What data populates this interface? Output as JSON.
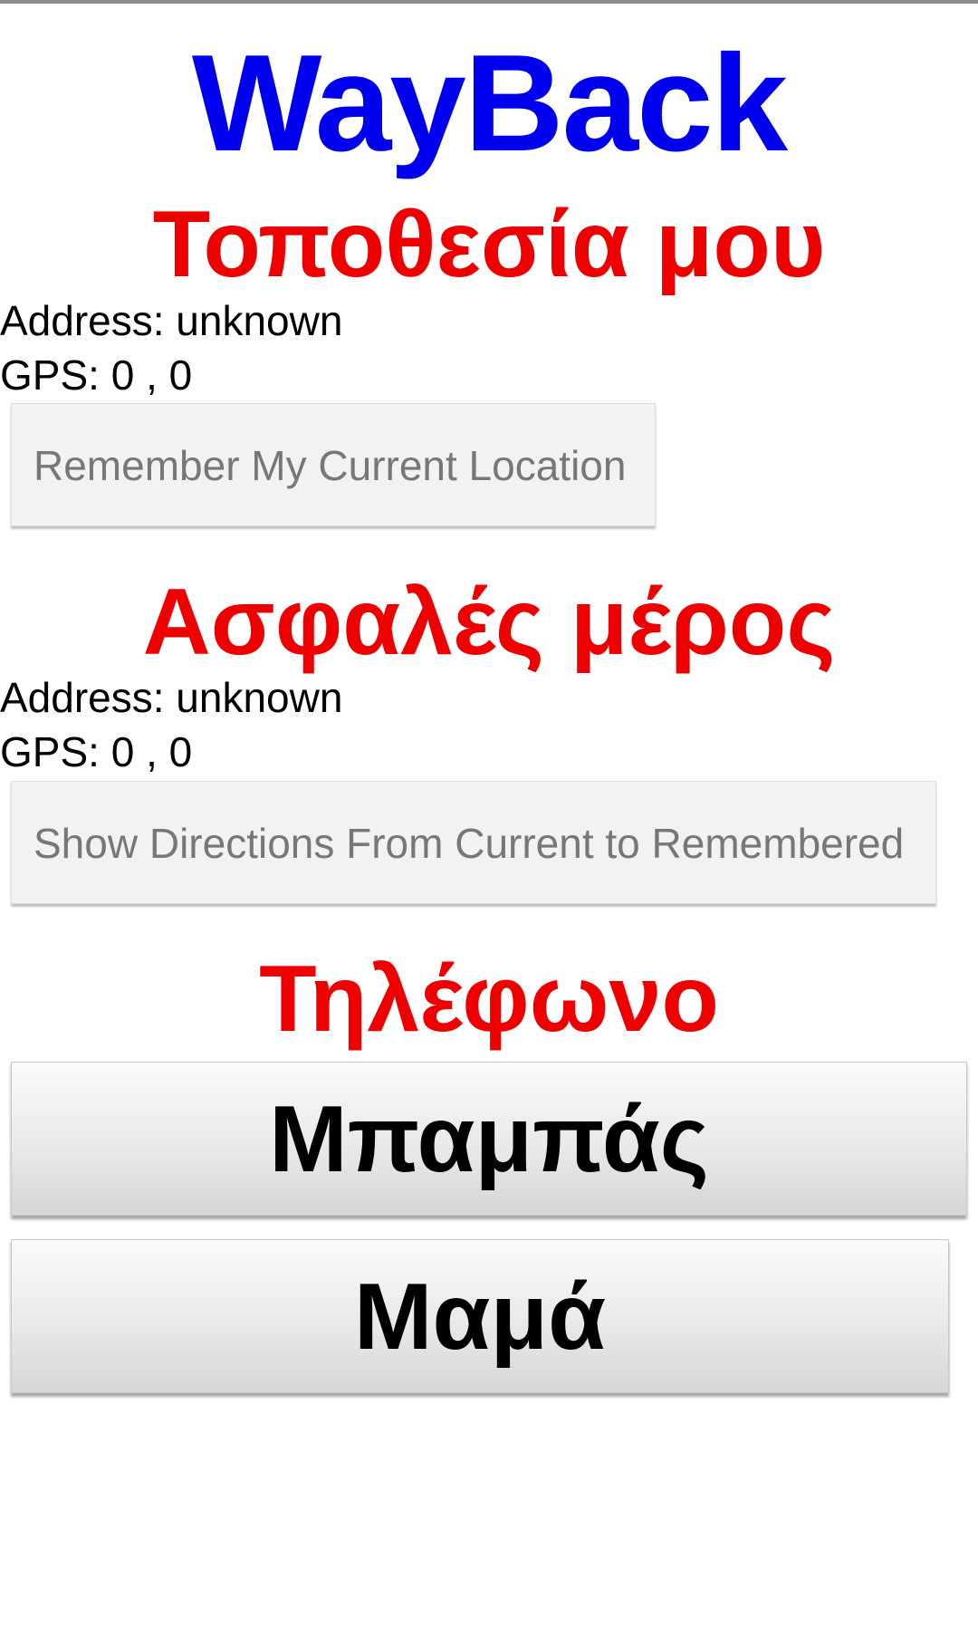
{
  "app": {
    "title": "WayBack",
    "title_color": "#0000ee",
    "heading_color": "#ee0000"
  },
  "my_location": {
    "heading": "Τοποθεσία μου",
    "address": "Address: unknown",
    "gps": "GPS: 0 , 0",
    "button_label": "Remember My Current Location"
  },
  "safe_place": {
    "heading": "Ασφαλές μέρος",
    "address": "Address: unknown",
    "gps": "GPS: 0 , 0",
    "button_label": "Show Directions From Current to Remembered"
  },
  "phone": {
    "heading": "Τηλέφωνο",
    "dad_label": "Μπαμπάς",
    "mom_label": "Μαμά"
  }
}
